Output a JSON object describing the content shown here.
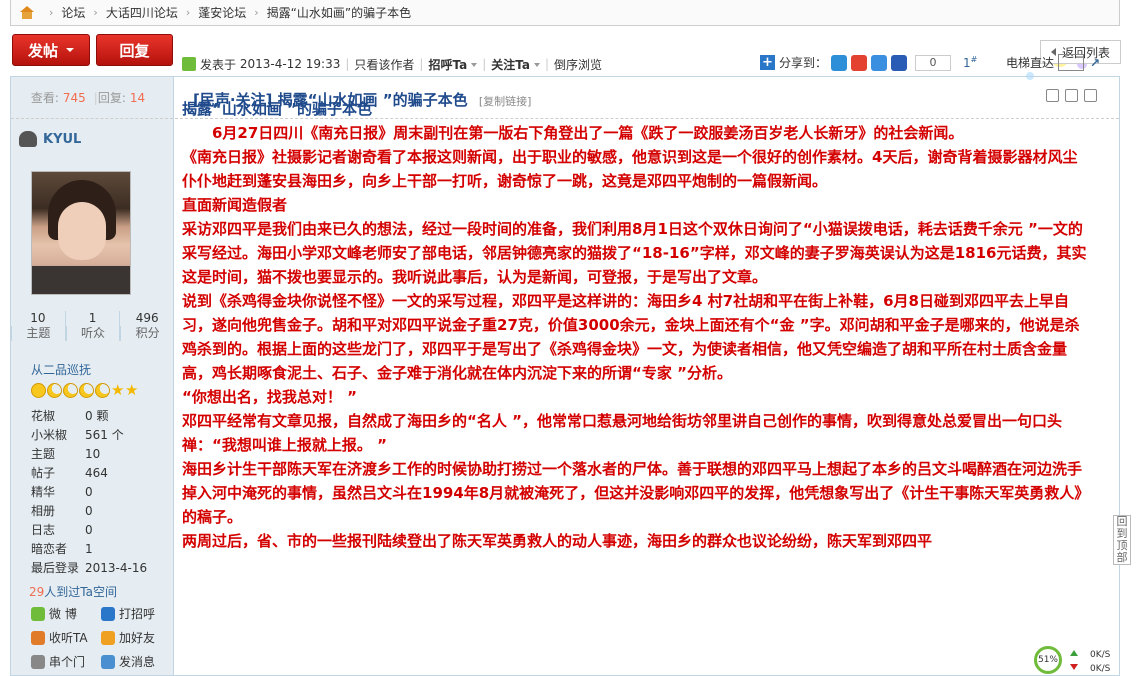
{
  "breadcrumb": [
    "论坛",
    "大话四川论坛",
    "蓬安论坛",
    "揭露“山水如画”的骗子本色"
  ],
  "toolbar": {
    "post_label": "发帖",
    "reply_label": "回复",
    "back_label": "返回列表"
  },
  "thread": {
    "views_label": "查看:",
    "views": "745",
    "replies_label": "回复:",
    "replies": "14",
    "title": "[民声·关注] 揭露“山水如画 ”的骗子本色",
    "copy_link": "[复制链接]"
  },
  "author": {
    "name": "KYUL",
    "counts": [
      {
        "value": "10",
        "label": "主题"
      },
      {
        "value": "1",
        "label": "听众"
      },
      {
        "value": "496",
        "label": "积分"
      }
    ],
    "rank": "从二品巡抚",
    "profile": [
      {
        "k": "花椒",
        "v": "0 颗"
      },
      {
        "k": "小米椒",
        "v": "561 个"
      },
      {
        "k": "主题",
        "v": "10"
      },
      {
        "k": "帖子",
        "v": "464"
      },
      {
        "k": "精华",
        "v": "0"
      },
      {
        "k": "相册",
        "v": "0"
      },
      {
        "k": "日志",
        "v": "0"
      },
      {
        "k": "暗恋者",
        "v": "1"
      },
      {
        "k": "最后登录",
        "v": "2013-4-16"
      }
    ],
    "visitors_count": "29",
    "visitors_text": "人到过Ta空间",
    "actions": [
      {
        "label": "微 博",
        "icon": "weibo-icon",
        "color": "#6fbb3a"
      },
      {
        "label": "打招呼",
        "icon": "greet-icon",
        "color": "#2a77c9"
      },
      {
        "label": "收听TA",
        "icon": "follow-icon",
        "color": "#e07b2a"
      },
      {
        "label": "加好友",
        "icon": "add-friend-icon",
        "color": "#f0a020"
      },
      {
        "label": "串个门",
        "icon": "visit-icon",
        "color": "#888888"
      },
      {
        "label": "发消息",
        "icon": "message-icon",
        "color": "#4a8fd0"
      }
    ]
  },
  "meta": {
    "posted_label": "发表于",
    "posted_time": "2013-4-12 19:33",
    "only_author": "只看该作者",
    "greet": "招呼Ta",
    "follow": "关注Ta",
    "reverse": "倒序浏览",
    "share_label": "分享到：",
    "share_count": "0",
    "floor": "1",
    "floor_sup": "#",
    "elevator": "电梯直达"
  },
  "content": {
    "heading": "揭露“山水如画 ”的骗子本色",
    "paragraphs": [
      "6月27日四川《南充日报》周末副刊在第一版右下角登出了一篇《跌了一跤服姜汤百岁老人长新牙》的社会新闻。",
      "《南充日报》社摄影记者谢奇看了本报这则新闻，出于职业的敏感，他意识到这是一个很好的创作素材。4天后，谢奇背着摄影器材风尘仆仆地赶到蓬安县海田乡，向乡上干部一打听，谢奇惊了一跳，这竟是邓四平炮制的一篇假新闻。",
      "直面新闻造假者",
      "采访邓四平是我们由来已久的想法，经过一段时间的准备，我们利用8月1日这个双休日询问了“小猫误拨电话，耗去话费千余元 ”一文的采写经过。海田小学邓文峰老师安了部电话，邻居钟德亮家的猫拨了“18-16”字样，邓文峰的妻子罗海英误认为这是1816元话费，其实这是时间，猫不拨也要显示的。我听说此事后，认为是新闻，可登报，于是写出了文章。",
      "说到《杀鸡得金块你说怪不怪》一文的采写过程，邓四平是这样讲的：海田乡4 村7社胡和平在街上补鞋，6月8日碰到邓四平去上早自习，遂向他兜售金子。胡和平对邓四平说金子重27克，价值3000余元，金块上面还有个“金 ”字。邓问胡和平金子是哪来的，他说是杀鸡杀到的。根据上面的这些龙门了，邓四平于是写出了《杀鸡得金块》一文，为使读者相信，他又凭空编造了胡和平所在村土质含金量高，鸡长期啄食泥土、石子、金子难于消化就在体内沉淀下来的所谓“专家 ”分析。",
      "“你想出名，找我总对！ ”",
      "邓四平经常有文章见报，自然成了海田乡的“名人 ”，他常常口惹悬河地给街坊邻里讲自己创作的事情，吹到得意处总爱冒出一句口头禅：“我想叫谁上报就上报。 ”",
      "海田乡计生干部陈天军在济渡乡工作的时候协助打捞过一个落水者的尸体。善于联想的邓四平马上想起了本乡的吕文斗喝醉酒在河边洗手掉入河中淹死的事情，虽然吕文斗在1994年8月就被淹死了，但这并没影响邓四平的发挥，他凭想象写出了《计生干事陈天军英勇救人》的稿子。",
      "两周过后，省、市的一些报刊陆续登出了陈天军英勇救人的动人事迹，海田乡的群众也议论纷纷，陈天军到邓四平"
    ]
  },
  "side": {
    "back_top": "回到顶部"
  },
  "speed": {
    "percent": "51%",
    "up": "0K/S",
    "down": "0K/S"
  }
}
